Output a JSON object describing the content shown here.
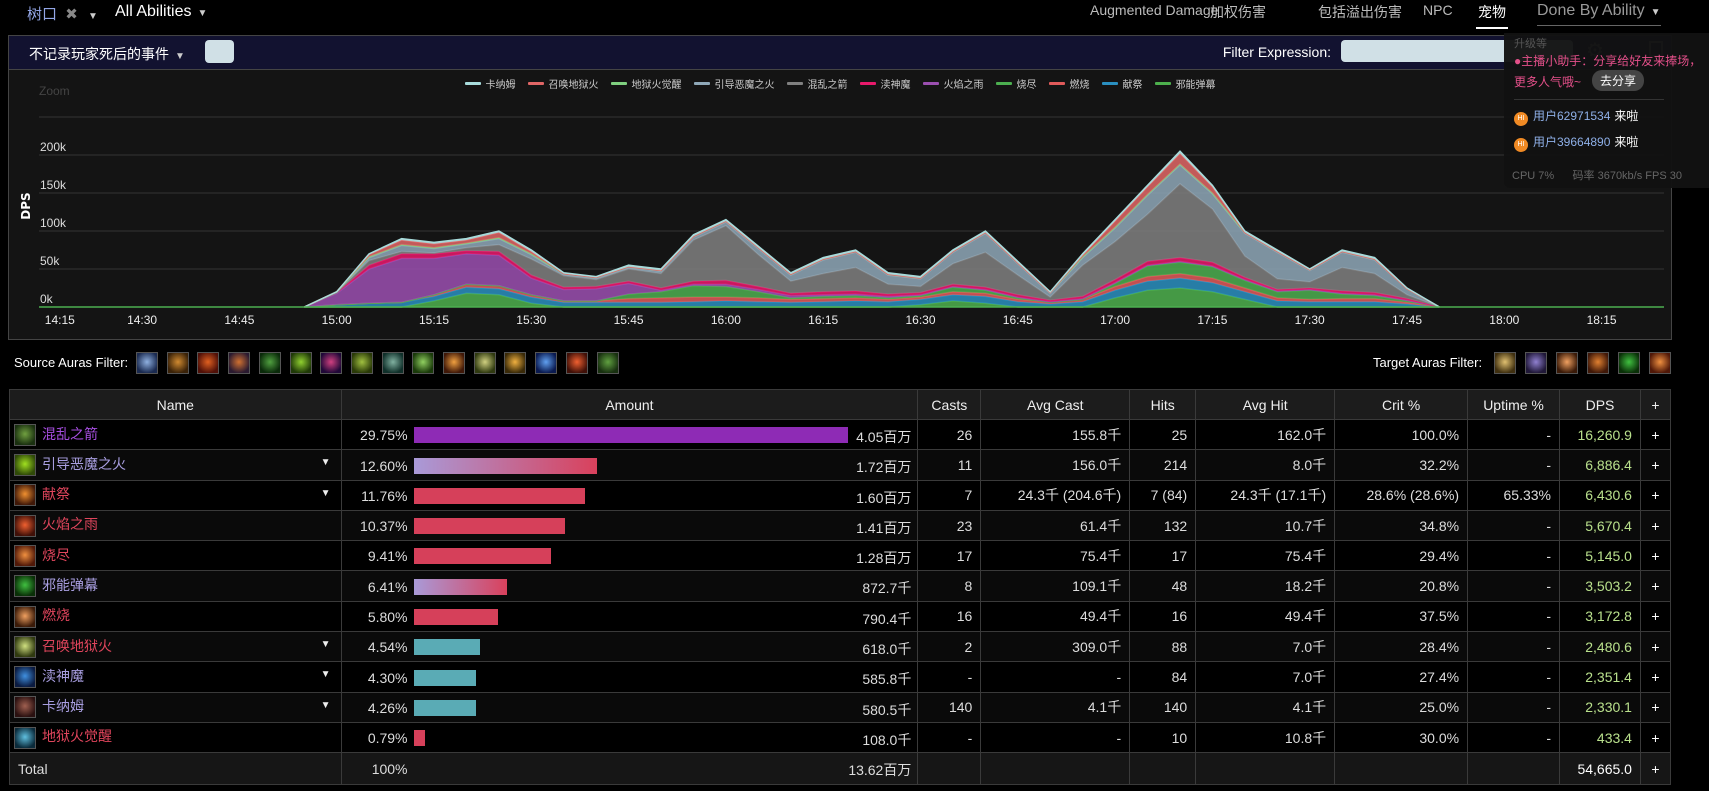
{
  "topbar": {
    "player": "树口",
    "scope": "All Abilities",
    "tabs": [
      {
        "label": "Augmented Damage"
      },
      {
        "label": "加权伤害"
      },
      {
        "label": "包括溢出伤害"
      },
      {
        "label": "NPC"
      },
      {
        "label": "宠物",
        "active": true
      }
    ],
    "view": "Done By Ability"
  },
  "filterbar": {
    "death_filter": "不记录玩家死后的事件",
    "filter_label": "Filter Expression:",
    "filter_value": ""
  },
  "overlay": {
    "upgrade": "升级等",
    "assistant_line1": "主播小助手：分享给好友来捧场，",
    "assistant_line2": "更多人气哦~",
    "share_button": "去分享",
    "users": [
      {
        "badge": "HI",
        "name": "用户62971534",
        "action": "来啦"
      },
      {
        "badge": "HI",
        "name": "用户39664890",
        "action": "来啦"
      }
    ],
    "cpu": "CPU 7%",
    "bitrate": "码率 3670kb/s",
    "fps": "FPS 30"
  },
  "chart_data": {
    "type": "area",
    "stacked": true,
    "zoom_label": "Zoom",
    "ylabel": "DPS",
    "ylim": [
      0,
      250000
    ],
    "yticks": [
      "0k",
      "50k",
      "100k",
      "150k",
      "200k"
    ],
    "xticks": [
      "14:15",
      "14:30",
      "14:45",
      "15:00",
      "15:15",
      "15:30",
      "15:45",
      "16:00",
      "16:15",
      "16:30",
      "16:45",
      "17:00",
      "17:15",
      "17:30",
      "17:45",
      "18:00",
      "18:15"
    ],
    "x": [
      "14:55",
      "15:00",
      "15:05",
      "15:10",
      "15:15",
      "15:20",
      "15:25",
      "15:30",
      "15:35",
      "15:40",
      "15:45",
      "15:50",
      "15:55",
      "16:00",
      "16:05",
      "16:10",
      "16:15",
      "16:20",
      "16:25",
      "16:30",
      "16:35",
      "16:40",
      "16:45",
      "16:50",
      "16:55",
      "17:00",
      "17:05",
      "17:10",
      "17:15",
      "17:20",
      "17:25",
      "17:30",
      "17:35",
      "17:40",
      "17:45",
      "17:50"
    ],
    "legend_order": [
      "卡纳姆",
      "召唤地狱火",
      "地狱火觉醒",
      "引导恶魔之火",
      "混乱之箭",
      "渎神魔",
      "火焰之雨",
      "烧尽",
      "燃烧",
      "献祭",
      "邪能弹幕"
    ],
    "legend_position": "top",
    "series": [
      {
        "name": "邪能弹幕",
        "color": "#4db04d",
        "values": [
          0,
          0,
          0,
          0,
          8,
          18,
          16,
          5,
          0,
          0,
          0,
          0,
          0,
          0,
          0,
          0,
          0,
          0,
          0,
          3,
          8,
          5,
          0,
          0,
          0,
          12,
          22,
          25,
          20,
          10,
          0,
          0,
          0,
          0,
          0,
          0
        ]
      },
      {
        "name": "献祭",
        "color": "#2a8fc0",
        "values": [
          0,
          3,
          5,
          6,
          6,
          8,
          8,
          8,
          6,
          6,
          6,
          6,
          7,
          8,
          7,
          6,
          7,
          8,
          7,
          7,
          8,
          9,
          7,
          4,
          7,
          10,
          12,
          13,
          12,
          10,
          8,
          7,
          7,
          7,
          4,
          0
        ]
      },
      {
        "name": "燃烧",
        "color": "#e05a5a",
        "values": [
          0,
          0,
          0,
          0,
          2,
          4,
          4,
          3,
          2,
          2,
          5,
          6,
          6,
          5,
          5,
          4,
          4,
          4,
          3,
          3,
          4,
          4,
          3,
          2,
          3,
          5,
          6,
          6,
          6,
          5,
          4,
          3,
          4,
          4,
          2,
          0
        ]
      },
      {
        "name": "烧尽",
        "color": "#4caf50",
        "values": [
          0,
          0,
          0,
          0,
          0,
          0,
          0,
          0,
          0,
          0,
          6,
          8,
          15,
          14,
          8,
          2,
          3,
          3,
          2,
          2,
          6,
          4,
          2,
          0,
          0,
          4,
          14,
          15,
          15,
          10,
          8,
          12,
          6,
          4,
          2,
          0
        ]
      },
      {
        "name": "火焰之雨",
        "color": "#9b4fb0",
        "values": [
          0,
          15,
          45,
          58,
          48,
          40,
          40,
          22,
          15,
          16,
          14,
          2,
          2,
          3,
          3,
          3,
          2,
          2,
          2,
          1,
          1,
          1,
          1,
          1,
          1,
          1,
          1,
          1,
          1,
          1,
          1,
          1,
          1,
          1,
          1,
          0
        ]
      },
      {
        "name": "渎神魔",
        "color": "#e8196b",
        "values": [
          0,
          1,
          5,
          6,
          6,
          4,
          5,
          4,
          3,
          3,
          3,
          3,
          4,
          5,
          4,
          3,
          4,
          4,
          3,
          3,
          3,
          3,
          3,
          2,
          3,
          4,
          5,
          5,
          5,
          3,
          2,
          2,
          3,
          3,
          2,
          0
        ]
      },
      {
        "name": "混乱之箭",
        "color": "#808080",
        "values": [
          0,
          0,
          6,
          3,
          1,
          4,
          9,
          21,
          15,
          9,
          16,
          19,
          54,
          72,
          42,
          16,
          24,
          31,
          13,
          8,
          27,
          46,
          26,
          4,
          41,
          50,
          62,
          97,
          70,
          28,
          14,
          8,
          31,
          25,
          5,
          0
        ]
      },
      {
        "name": "引导恶魔之火",
        "color": "#8fa8b8",
        "values": [
          0,
          1,
          4,
          8,
          6,
          5,
          8,
          6,
          2,
          2,
          2,
          3,
          4,
          5,
          8,
          8,
          18,
          20,
          12,
          10,
          15,
          25,
          15,
          5,
          10,
          18,
          25,
          25,
          20,
          30,
          35,
          15,
          20,
          18,
          8,
          0
        ]
      },
      {
        "name": "地狱火觉醒",
        "color": "#80d080",
        "values": [
          0,
          0,
          1,
          1,
          1,
          1,
          1,
          1,
          1,
          1,
          1,
          1,
          1,
          1,
          1,
          1,
          1,
          1,
          1,
          1,
          1,
          1,
          1,
          1,
          1,
          1,
          1,
          1,
          1,
          1,
          1,
          1,
          1,
          1,
          0,
          0
        ]
      },
      {
        "name": "召唤地狱火",
        "color": "#e06666",
        "values": [
          0,
          0,
          3,
          6,
          5,
          4,
          7,
          3,
          0,
          0,
          0,
          0,
          0,
          0,
          0,
          0,
          0,
          0,
          0,
          0,
          0,
          0,
          0,
          0,
          2,
          8,
          10,
          14,
          8,
          0,
          0,
          0,
          0,
          0,
          0,
          0
        ]
      },
      {
        "name": "卡纳姆",
        "color": "#a8dcdc",
        "values": [
          0,
          0,
          1,
          2,
          2,
          2,
          2,
          2,
          1,
          1,
          2,
          2,
          2,
          2,
          2,
          2,
          2,
          2,
          2,
          2,
          2,
          2,
          2,
          1,
          2,
          2,
          2,
          3,
          2,
          2,
          2,
          1,
          2,
          2,
          1,
          0
        ]
      }
    ],
    "value_unit": "k"
  },
  "auras": {
    "source_label": "Source Auras Filter:",
    "target_label": "Target Auras Filter:",
    "source_icons": [
      [
        "#1a2a50",
        "#8fb0e0"
      ],
      [
        "#3a2208",
        "#d08a30"
      ],
      [
        "#501008",
        "#e06020"
      ],
      [
        "#2a1a30",
        "#d07030"
      ],
      [
        "#0a2a0a",
        "#50a040"
      ],
      [
        "#203a08",
        "#90d030"
      ],
      [
        "#200838",
        "#d04080"
      ],
      [
        "#2a3a08",
        "#a0c040"
      ],
      [
        "#10302a",
        "#80b0a0"
      ],
      [
        "#1a3a0a",
        "#90d060"
      ],
      [
        "#401808",
        "#f0a040"
      ],
      [
        "#303a10",
        "#d0d080"
      ],
      [
        "#3a2a08",
        "#f0b040"
      ],
      [
        "#0a1a50",
        "#60a0f0"
      ],
      [
        "#401008",
        "#f06030"
      ],
      [
        "#183010",
        "#60a040"
      ]
    ],
    "target_icons": [
      [
        "#403010",
        "#e0c070"
      ],
      [
        "#201838",
        "#9080d0"
      ],
      [
        "#3a1a08",
        "#f0a060"
      ],
      [
        "#401808",
        "#e08030"
      ],
      [
        "#0a3008",
        "#40c040"
      ],
      [
        "#501808",
        "#f09040"
      ]
    ]
  },
  "table": {
    "headers": [
      "Name",
      "Amount",
      "Casts",
      "Avg Cast",
      "Hits",
      "Avg Hit",
      "Crit %",
      "Uptime %",
      "DPS",
      "+"
    ],
    "colors": {
      "purple_name": "#a64ee0",
      "lavender_name": "#a89ee0",
      "red_name": "#e0455c",
      "purple_bar": "#8e2bb5",
      "red_bar": "#d6405a",
      "teal_bar": "#5aabb5",
      "gradient_from": "#a99ad8",
      "gradient_to": "#d9415c",
      "dps": "#b9e08c"
    },
    "rows": [
      {
        "name": "混乱之箭",
        "color": "purple_name",
        "icon": [
          "#1a3010",
          "#70a040"
        ],
        "dropdown": false,
        "pct": "29.75%",
        "pct_value": 29.75,
        "bar": "purple",
        "amount": "4.05百万",
        "casts": "26",
        "avg_cast": "155.8千",
        "hits": "25",
        "avg_hit": "162.0千",
        "crit": "100.0%",
        "uptime": "-",
        "dps": "16,260.9"
      },
      {
        "name": "引导恶魔之火",
        "color": "lavender_name",
        "icon": [
          "#304a08",
          "#a0e020"
        ],
        "dropdown": true,
        "pct": "12.60%",
        "pct_value": 12.6,
        "bar": "gradient",
        "amount": "1.72百万",
        "casts": "11",
        "avg_cast": "156.0千",
        "hits": "214",
        "avg_hit": "8.0千",
        "crit": "32.2%",
        "uptime": "-",
        "dps": "6,886.4"
      },
      {
        "name": "献祭",
        "color": "red_name",
        "icon": [
          "#401808",
          "#f09030"
        ],
        "dropdown": true,
        "pct": "11.76%",
        "pct_value": 11.76,
        "bar": "red",
        "amount": "1.60百万",
        "casts": "7",
        "avg_cast": "24.3千 (204.6千)",
        "hits": "7 (84)",
        "avg_hit": "24.3千 (17.1千)",
        "crit": "28.6% (28.6%)",
        "uptime": "65.33%",
        "dps": "6,430.6"
      },
      {
        "name": "火焰之雨",
        "color": "red_name",
        "icon": [
          "#401008",
          "#f06030"
        ],
        "dropdown": false,
        "pct": "10.37%",
        "pct_value": 10.37,
        "bar": "red",
        "amount": "1.41百万",
        "casts": "23",
        "avg_cast": "61.4千",
        "hits": "132",
        "avg_hit": "10.7千",
        "crit": "34.8%",
        "uptime": "-",
        "dps": "5,670.4"
      },
      {
        "name": "烧尽",
        "color": "red_name",
        "icon": [
          "#501808",
          "#f09040"
        ],
        "dropdown": false,
        "pct": "9.41%",
        "pct_value": 9.41,
        "bar": "red",
        "amount": "1.28百万",
        "casts": "17",
        "avg_cast": "75.4千",
        "hits": "17",
        "avg_hit": "75.4千",
        "crit": "29.4%",
        "uptime": "-",
        "dps": "5,145.0"
      },
      {
        "name": "邪能弹幕",
        "color": "lavender_name",
        "icon": [
          "#0a3008",
          "#40c040"
        ],
        "dropdown": false,
        "pct": "6.41%",
        "pct_value": 6.41,
        "bar": "gradient",
        "amount": "872.7千",
        "casts": "8",
        "avg_cast": "109.1千",
        "hits": "48",
        "avg_hit": "18.2千",
        "crit": "20.8%",
        "uptime": "-",
        "dps": "3,503.2"
      },
      {
        "name": "燃烧",
        "color": "red_name",
        "icon": [
          "#3a1a08",
          "#f0a060"
        ],
        "dropdown": false,
        "pct": "5.80%",
        "pct_value": 5.8,
        "bar": "red",
        "amount": "790.4千",
        "casts": "16",
        "avg_cast": "49.4千",
        "hits": "16",
        "avg_hit": "49.4千",
        "crit": "37.5%",
        "uptime": "-",
        "dps": "3,172.8"
      },
      {
        "name": "召唤地狱火",
        "color": "red_name",
        "icon": [
          "#303a10",
          "#d0e080"
        ],
        "dropdown": true,
        "pct": "4.54%",
        "pct_value": 4.54,
        "bar": "teal",
        "amount": "618.0千",
        "casts": "2",
        "avg_cast": "309.0千",
        "hits": "88",
        "avg_hit": "7.0千",
        "crit": "28.4%",
        "uptime": "-",
        "dps": "2,480.6"
      },
      {
        "name": "渎神魔",
        "color": "lavender_name",
        "icon": [
          "#0a1a40",
          "#4090e0"
        ],
        "dropdown": true,
        "pct": "4.30%",
        "pct_value": 4.3,
        "bar": "teal",
        "amount": "585.8千",
        "casts": "-",
        "avg_cast": "-",
        "hits": "84",
        "avg_hit": "7.0千",
        "crit": "27.4%",
        "uptime": "-",
        "dps": "2,351.4"
      },
      {
        "name": "卡纳姆",
        "color": "lavender_name",
        "icon": [
          "#2a1010",
          "#a06050"
        ],
        "dropdown": true,
        "pct": "4.26%",
        "pct_value": 4.26,
        "bar": "teal",
        "amount": "580.5千",
        "casts": "140",
        "avg_cast": "4.1千",
        "hits": "140",
        "avg_hit": "4.1千",
        "crit": "25.0%",
        "uptime": "-",
        "dps": "2,330.1"
      },
      {
        "name": "地狱火觉醒",
        "color": "red_name",
        "icon": [
          "#0a2a3a",
          "#60c0e0"
        ],
        "dropdown": false,
        "pct": "0.79%",
        "pct_value": 0.79,
        "bar": "red",
        "amount": "108.0千",
        "casts": "-",
        "avg_cast": "-",
        "hits": "10",
        "avg_hit": "10.8千",
        "crit": "30.0%",
        "uptime": "-",
        "dps": "433.4"
      }
    ],
    "total": {
      "label": "Total",
      "pct": "100%",
      "amount": "13.62百万",
      "dps": "54,665.0"
    }
  }
}
